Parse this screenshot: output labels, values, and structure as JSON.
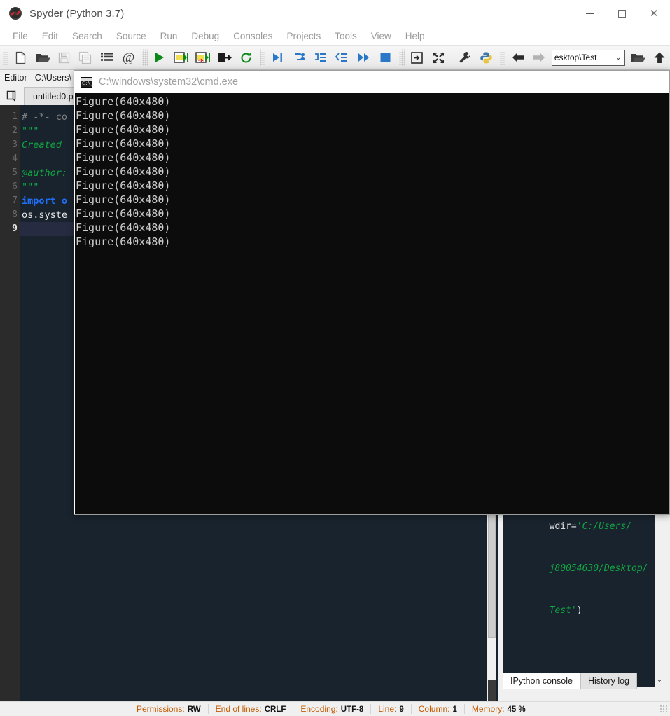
{
  "window": {
    "title": "Spyder (Python 3.7)",
    "icon": "spyder-icon",
    "minimize": "minimize",
    "maximize": "maximize",
    "close": "close"
  },
  "menubar": {
    "items": [
      {
        "label": "File"
      },
      {
        "label": "Edit"
      },
      {
        "label": "Search"
      },
      {
        "label": "Source"
      },
      {
        "label": "Run"
      },
      {
        "label": "Debug"
      },
      {
        "label": "Consoles"
      },
      {
        "label": "Projects"
      },
      {
        "label": "Tools"
      },
      {
        "label": "View"
      },
      {
        "label": "Help"
      }
    ]
  },
  "toolbar": {
    "buttons": [
      {
        "name": "new-file-icon"
      },
      {
        "name": "open-file-icon"
      },
      {
        "name": "save-file-icon"
      },
      {
        "name": "save-all-icon"
      },
      {
        "name": "file-switcher-icon"
      },
      {
        "name": "find-symbols-icon"
      },
      {
        "name": "run-file-icon"
      },
      {
        "name": "run-cell-icon"
      },
      {
        "name": "run-cell-advance-icon"
      },
      {
        "name": "run-selection-icon"
      },
      {
        "name": "re-run-icon"
      },
      {
        "name": "debug-file-icon"
      },
      {
        "name": "step-over-icon"
      },
      {
        "name": "step-into-icon"
      },
      {
        "name": "step-return-icon"
      },
      {
        "name": "continue-icon"
      },
      {
        "name": "stop-debug-icon"
      },
      {
        "name": "maximize-pane-icon"
      },
      {
        "name": "fullscreen-icon"
      },
      {
        "name": "preferences-icon"
      },
      {
        "name": "pythonpath-manager-icon"
      },
      {
        "name": "back-icon"
      },
      {
        "name": "forward-icon"
      }
    ],
    "path_value": "esktop\\Test",
    "path_chevron": "⌄",
    "browse_dir_icon": "open-folder-icon",
    "parent_dir_icon": "up-arrow-icon"
  },
  "editor": {
    "header": "Editor - C:\\Users\\",
    "browse_tabs_icon": "browse-tabs-icon",
    "tab_label": "untitled0.p",
    "current_line": 9,
    "lines": [
      {
        "num": 1,
        "tokens": [
          {
            "cls": "tok-comment",
            "text": "# -*- co"
          }
        ]
      },
      {
        "num": 2,
        "tokens": [
          {
            "cls": "tok-string",
            "text": "\"\"\""
          }
        ]
      },
      {
        "num": 3,
        "tokens": [
          {
            "cls": "tok-string",
            "text": "Created"
          }
        ]
      },
      {
        "num": 4,
        "tokens": [
          {
            "cls": "tok-string",
            "text": ""
          }
        ]
      },
      {
        "num": 5,
        "tokens": [
          {
            "cls": "tok-string",
            "text": "@author:"
          }
        ]
      },
      {
        "num": 6,
        "tokens": [
          {
            "cls": "tok-string",
            "text": "\"\"\""
          }
        ]
      },
      {
        "num": 7,
        "tokens": [
          {
            "cls": "tok-kw",
            "text": "import o"
          }
        ]
      },
      {
        "num": 8,
        "tokens": [
          {
            "cls": "tok-plain",
            "text": "os.syste"
          }
        ]
      },
      {
        "num": 9,
        "tokens": [
          {
            "cls": "tok-plain",
            "text": ""
          }
        ]
      }
    ]
  },
  "cmd_window": {
    "icon": "cmd-icon",
    "title": "C:\\windows\\system32\\cmd.exe",
    "output_lines": [
      "Figure(640x480)",
      "Figure(640x480)",
      "Figure(640x480)",
      "Figure(640x480)",
      "Figure(640x480)",
      "Figure(640x480)",
      "Figure(640x480)",
      "Figure(640x480)",
      "Figure(640x480)",
      "Figure(640x480)",
      "Figure(640x480)"
    ]
  },
  "console": {
    "lines": [
      [
        {
          "cls": "c-white",
          "text": "wdir="
        },
        {
          "cls": "c-green",
          "text": "'C:/Users/"
        }
      ],
      [
        {
          "cls": "c-green",
          "text": "j80054630/Desktop/"
        }
      ],
      [
        {
          "cls": "c-green",
          "text": "Test'"
        },
        {
          "cls": "c-white",
          "text": ")"
        }
      ]
    ],
    "scroll_chevron": "⌄",
    "tabs": [
      {
        "label": "IPython console",
        "active": true
      },
      {
        "label": "History log",
        "active": false
      }
    ]
  },
  "statusbar": {
    "items": [
      {
        "label": "Permissions:",
        "value": "RW"
      },
      {
        "label": "End of lines:",
        "value": "CRLF"
      },
      {
        "label": "Encoding:",
        "value": "UTF-8"
      },
      {
        "label": "Line:",
        "value": "9"
      },
      {
        "label": "Column:",
        "value": "1"
      },
      {
        "label": "Memory:",
        "value": "45 %"
      }
    ]
  },
  "colors": {
    "editor_bg": "#19232d",
    "gutter_bg": "#2b2b2b",
    "cmd_bg": "#0c0c0c",
    "string_green": "#11a642",
    "keyword_blue": "#2070ff",
    "status_orange": "#c45a00",
    "chrome_gray": "#f0f0f0"
  }
}
